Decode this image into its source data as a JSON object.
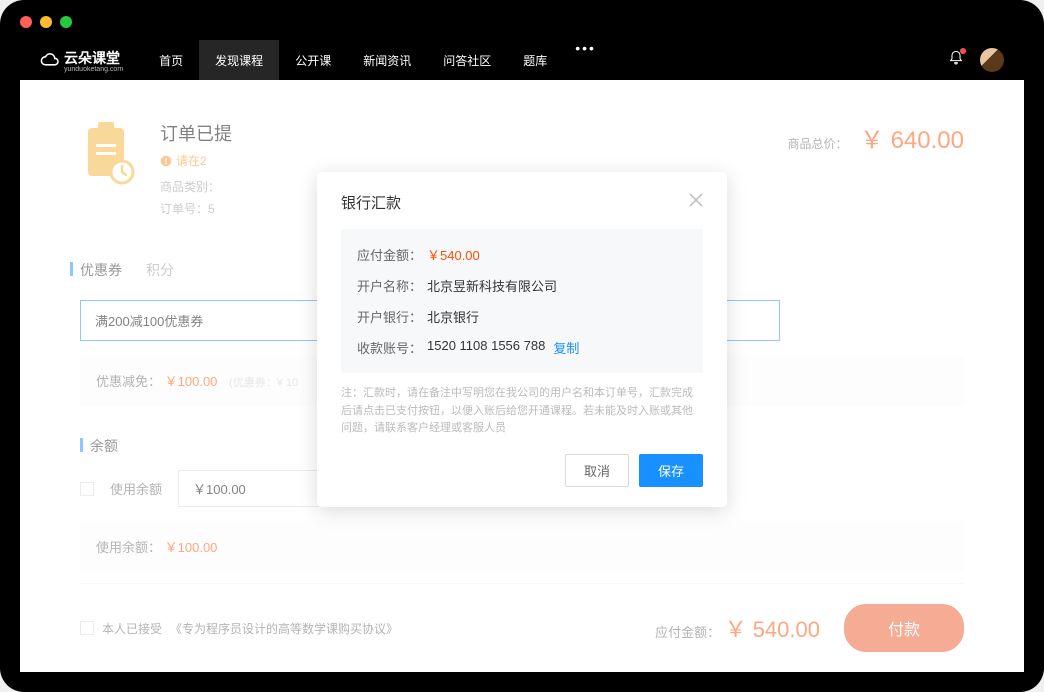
{
  "nav": {
    "logo": "云朵课堂",
    "logo_sub": "yunduoketang.com",
    "items": [
      "首页",
      "发现课程",
      "公开课",
      "新闻资讯",
      "问答社区",
      "题库"
    ],
    "active_index": 1
  },
  "order": {
    "title": "订单已提",
    "warn_prefix": "请在2",
    "meta_category_label": "商品类别：",
    "meta_orderno_label": "订单号：5",
    "total_label": "商品总价：",
    "total_value": "￥ 640.00"
  },
  "coupon": {
    "tabs": [
      "优惠券",
      "积分"
    ],
    "input_value": "满200减100优惠券",
    "discount_label": "优惠减免：",
    "discount_value": "￥100.00",
    "discount_note": "(优惠券：¥ 10"
  },
  "balance": {
    "section_title": "余额",
    "use_label": "使用余额",
    "input_value": "￥100.00",
    "used_label": "使用余额：",
    "used_value": "￥100.00"
  },
  "footer": {
    "agree_prefix": "本人已接受",
    "agree_link": "《专为程序员设计的高等数学课购买协议》",
    "total_label": "应付金额：",
    "total_value": "￥ 540.00",
    "pay_btn": "付款"
  },
  "modal": {
    "title": "银行汇款",
    "rows": {
      "amount_label": "应付金额：",
      "amount_value": "￥540.00",
      "account_name_label": "开户名称：",
      "account_name_value": "北京昱新科技有限公司",
      "bank_label": "开户银行：",
      "bank_value": "北京银行",
      "account_no_label": "收款账号：",
      "account_no_value": "1520 1108 1556 788",
      "copy": "复制"
    },
    "note": "注：汇款时，请在备注中写明您在我公司的用户名和本订单号，汇款完成后请点击已支付按钮，以便入账后给您开通课程。若未能及时入账或其他问题，请联系客户经理或客服人员",
    "cancel": "取消",
    "save": "保存"
  }
}
